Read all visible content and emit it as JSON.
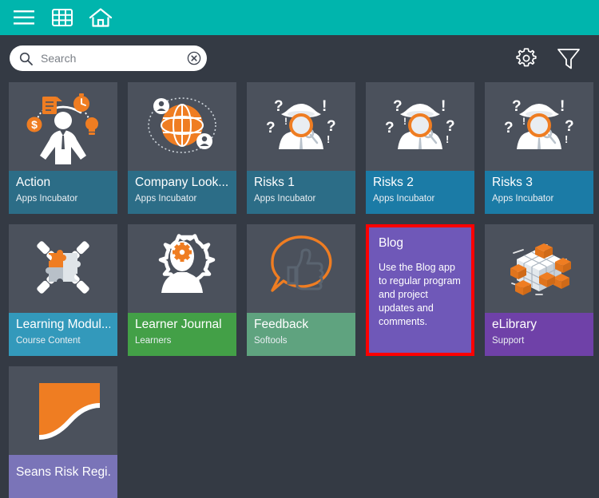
{
  "topbar": {
    "background": "#00b5ad",
    "icons": [
      {
        "name": "menu-icon",
        "label": "Menu"
      },
      {
        "name": "grid-icon",
        "label": "Apps grid"
      },
      {
        "name": "home-icon",
        "label": "Home"
      }
    ]
  },
  "search": {
    "placeholder": "Search",
    "value": "",
    "search_icon": "search-icon",
    "clear_icon": "clear-circle-icon"
  },
  "header_actions": [
    {
      "name": "settings-icon",
      "label": "Settings"
    },
    {
      "name": "filter-icon",
      "label": "Filter"
    }
  ],
  "colors": {
    "page_background": "#343a44",
    "tile_background": "#4b515c",
    "accent_orange": "#ef7d22",
    "teal_dark": "#2c6d87",
    "blue_bright": "#1b7ba6",
    "cyan": "#3399bb",
    "green": "#43a047",
    "sage": "#5fa37f",
    "purple": "#6f41a8",
    "purple_light": "#7a74b8",
    "selection_border": "#ff0000"
  },
  "tiles": [
    {
      "id": "action",
      "title": "Action",
      "subtitle": "Apps Incubator",
      "footer_color": "#2c6d87",
      "art": "action-person-icon",
      "type": "app"
    },
    {
      "id": "company-lookup",
      "title": "Company Look...",
      "subtitle": "Apps Incubator",
      "footer_color": "#2c6d87",
      "art": "globe-network-icon",
      "type": "app"
    },
    {
      "id": "risks-1",
      "title": "Risks 1",
      "subtitle": "Apps Incubator",
      "footer_color": "#2c6d87",
      "art": "detective-icon",
      "type": "app"
    },
    {
      "id": "risks-2",
      "title": "Risks 2",
      "subtitle": "Apps Incubator",
      "footer_color": "#1b7ba6",
      "art": "detective-icon",
      "type": "app"
    },
    {
      "id": "risks-3",
      "title": "Risks 3",
      "subtitle": "Apps Incubator",
      "footer_color": "#1b7ba6",
      "art": "detective-icon",
      "type": "app"
    },
    {
      "id": "learning-modules",
      "title": "Learning Modul...",
      "subtitle": "Course Content",
      "footer_color": "#3399bb",
      "art": "puzzle-chain-icon",
      "type": "app"
    },
    {
      "id": "learner-journal",
      "title": "Learner Journal",
      "subtitle": "Learners",
      "footer_color": "#43a047",
      "art": "head-gear-icon",
      "type": "app"
    },
    {
      "id": "feedback",
      "title": "Feedback",
      "subtitle": "Softools",
      "footer_color": "#5fa37f",
      "art": "thumbs-up-icon",
      "type": "app"
    },
    {
      "id": "blog",
      "title": "Blog",
      "body": "Use the Blog app to regular program and project updates and comments.",
      "footer_color": "#6f58b8",
      "type": "text",
      "selected": true
    },
    {
      "id": "elibrary",
      "title": "eLibrary",
      "subtitle": "Support",
      "footer_color": "#6f41a8",
      "art": "cube-blocks-icon",
      "type": "app"
    },
    {
      "id": "seans-risk-register",
      "title": "Seans Risk Regi...",
      "subtitle": "",
      "footer_color": "#7a74b8",
      "art": "orange-curve-chart-icon",
      "type": "app"
    }
  ]
}
